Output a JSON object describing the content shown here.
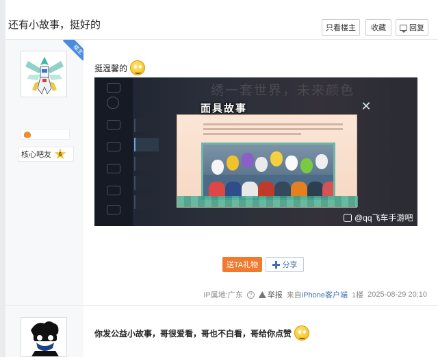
{
  "thread": {
    "title": "还有小故事，挺好的",
    "buttons": {
      "only_op": "只看楼主",
      "favorite": "收藏",
      "reply": "回复"
    }
  },
  "floor1": {
    "op_tag": "楼主",
    "badge_label": "核心吧友",
    "level": "6",
    "content_text": "挺温馨的",
    "image": {
      "bg_title": "绣一套世界，未来颜色",
      "popup_title": "面具故事",
      "watermark": "@qq飞车手游吧"
    },
    "gift_button": "送TA礼物",
    "share_button": "分享",
    "meta": {
      "ip_location": "IP属地:广东",
      "report": "举报",
      "client_prefix": "来自",
      "client": "iPhone客户端",
      "floor": "1楼",
      "timestamp": "2025-08-29 20:10"
    }
  },
  "floor2": {
    "content_text": "你发公益小故事，哥很爱看，哥也不白看，哥给你点赞"
  }
}
